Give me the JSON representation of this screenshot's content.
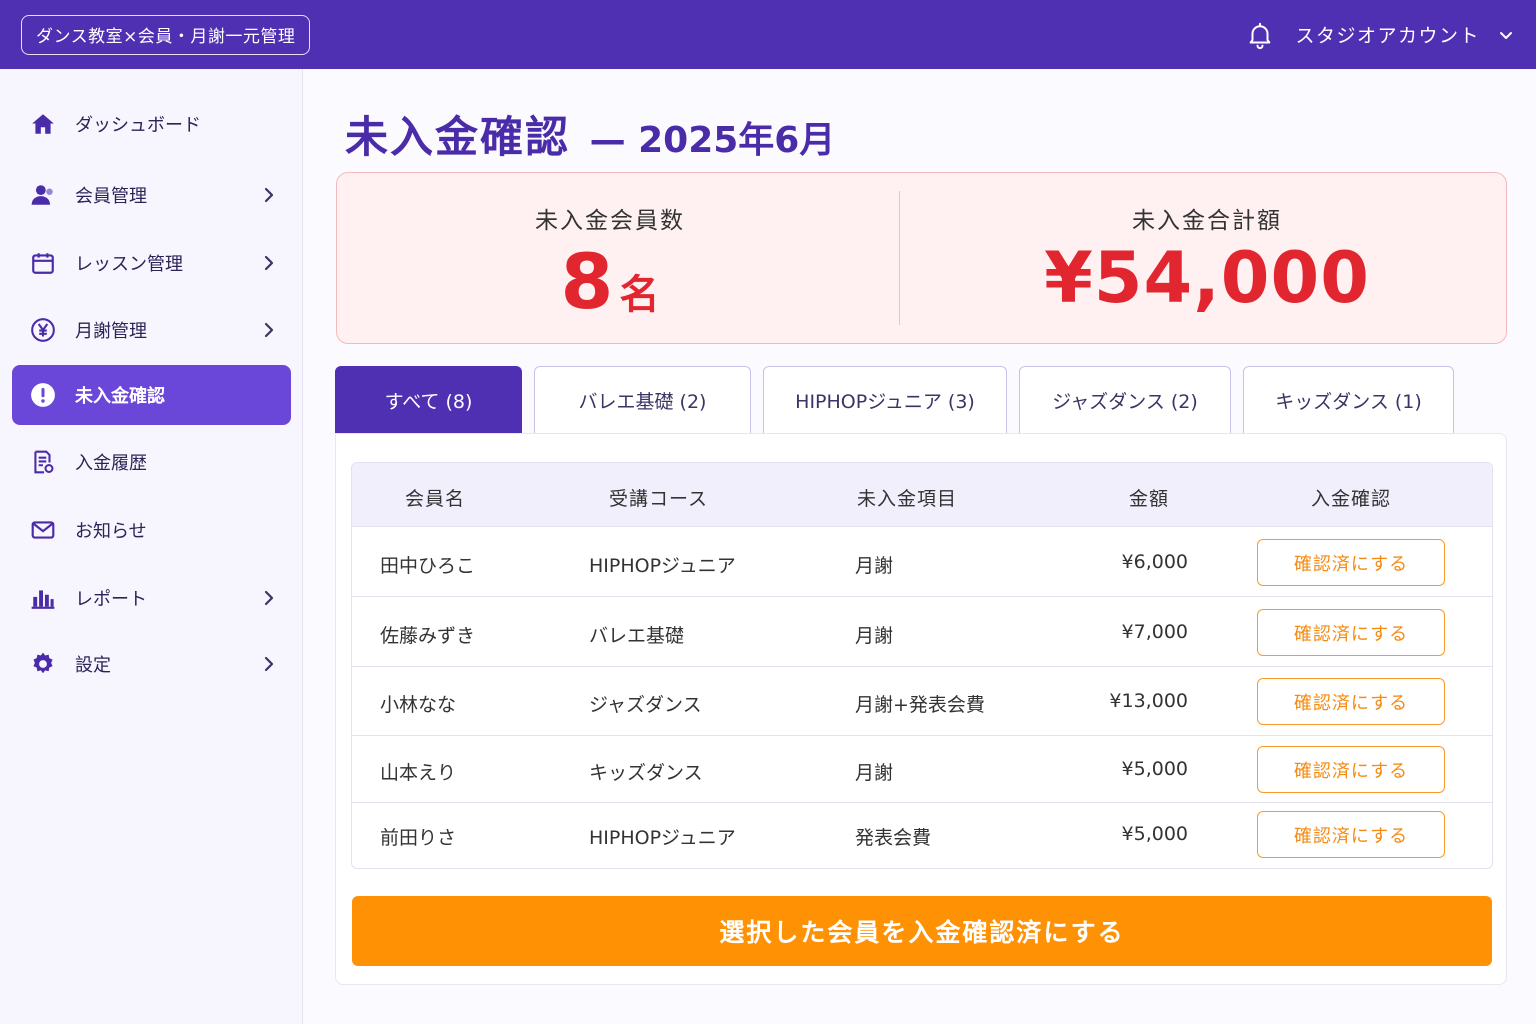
{
  "app": {
    "title": "ダンス教室×会員・月謝一元管理"
  },
  "account": {
    "label": "スタジオアカウント"
  },
  "sidebar": {
    "items": [
      {
        "label": "ダッシュボード",
        "icon": "home-icon"
      },
      {
        "label": "会員管理",
        "icon": "user-icon"
      },
      {
        "label": "レッスン管理",
        "icon": "calendar-icon"
      },
      {
        "label": "月謝管理",
        "icon": "yen-icon"
      },
      {
        "label": "未入金確認",
        "icon": "alert-icon"
      },
      {
        "label": "入金履歴",
        "icon": "document-icon"
      },
      {
        "label": "お知らせ",
        "icon": "mail-icon"
      },
      {
        "label": "レポート",
        "icon": "bar-chart-icon"
      },
      {
        "label": "設定",
        "icon": "gear-icon"
      }
    ],
    "active_index": 4
  },
  "page": {
    "title": "未入金確認",
    "period": "— 2025年6月"
  },
  "summary": {
    "unpaid_members_label": "未入金会員数",
    "unpaid_members_value": "8",
    "unpaid_members_unit": "名",
    "unpaid_total_label": "未入金合計額",
    "unpaid_total_value": "¥54,000"
  },
  "tabs": [
    {
      "label": "すべて (8)"
    },
    {
      "label": "バレエ基礎 (2)"
    },
    {
      "label": "HIPHOPジュニア (3)"
    },
    {
      "label": "ジャズダンス (2)"
    },
    {
      "label": "キッズダンス (1)"
    }
  ],
  "active_tab": 0,
  "table": {
    "headers": [
      "会員名",
      "受講コース",
      "未入金項目",
      "金額",
      "入金確認"
    ],
    "rows": [
      {
        "name": "田中ひろこ",
        "course": "HIPHOPジュニア",
        "item": "月謝",
        "amount": "¥6,000",
        "action": "確認済にする"
      },
      {
        "name": "佐藤みずき",
        "course": "バレエ基礎",
        "item": "月謝",
        "amount": "¥7,000",
        "action": "確認済にする"
      },
      {
        "name": "小林なな",
        "course": "ジャズダンス",
        "item": "月謝+発表会費",
        "amount": "¥13,000",
        "action": "確認済にする"
      },
      {
        "name": "山本えり",
        "course": "キッズダンス",
        "item": "月謝",
        "amount": "¥5,000",
        "action": "確認済にする"
      },
      {
        "name": "前田りさ",
        "course": "HIPHOPジュニア",
        "item": "発表会費",
        "amount": "¥5,000",
        "action": "確認済にする"
      }
    ]
  },
  "bulk_action": {
    "label": "選択した会員を入金確認済にする"
  },
  "colors": {
    "brand": "#4f2fb2",
    "active_nav": "#6a47d8",
    "alert_red": "#e2262f",
    "action_orange": "#fe9104"
  }
}
